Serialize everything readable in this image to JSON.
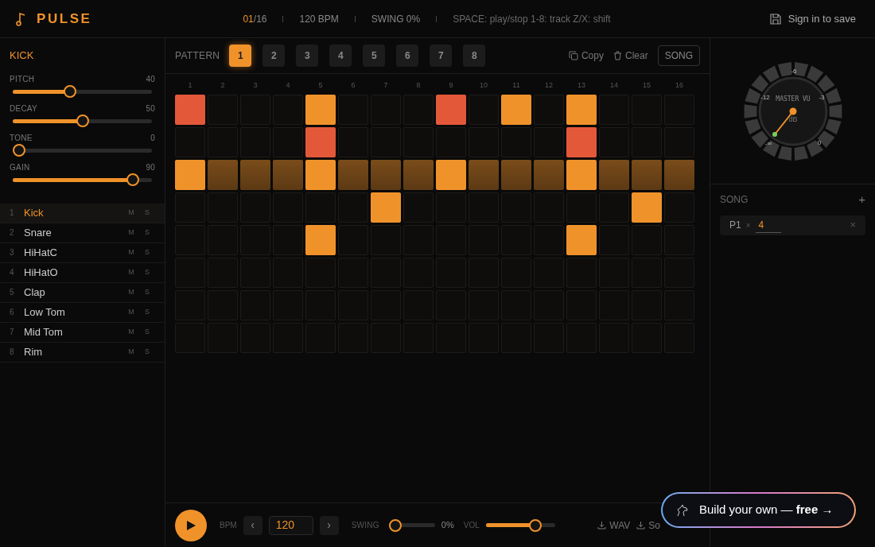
{
  "header": {
    "logo": "PULSE",
    "step_current": "01",
    "step_total": "/16",
    "bpm": "120 BPM",
    "swing": "SWING 0%",
    "hint": "SPACE: play/stop 1-8: track Z/X: shift",
    "sign_in": "Sign in to save"
  },
  "instrument": {
    "title": "KICK",
    "params": [
      {
        "label": "PITCH",
        "value": "40",
        "level": 0.4
      },
      {
        "label": "DECAY",
        "value": "50",
        "level": 0.5
      },
      {
        "label": "TONE",
        "value": "0",
        "level": 0
      },
      {
        "label": "GAIN",
        "value": "90",
        "level": 0.9
      }
    ]
  },
  "tracks": [
    {
      "index": "1",
      "name": "Kick",
      "mute": "M",
      "solo": "S",
      "selected": true
    },
    {
      "index": "2",
      "name": "Snare",
      "mute": "M",
      "solo": "S",
      "selected": false
    },
    {
      "index": "3",
      "name": "HiHatC",
      "mute": "M",
      "solo": "S",
      "selected": false
    },
    {
      "index": "4",
      "name": "HiHatO",
      "mute": "M",
      "solo": "S",
      "selected": false
    },
    {
      "index": "5",
      "name": "Clap",
      "mute": "M",
      "solo": "S",
      "selected": false
    },
    {
      "index": "6",
      "name": "Low Tom",
      "mute": "M",
      "solo": "S",
      "selected": false
    },
    {
      "index": "7",
      "name": "Mid Tom",
      "mute": "M",
      "solo": "S",
      "selected": false
    },
    {
      "index": "8",
      "name": "Rim",
      "mute": "M",
      "solo": "S",
      "selected": false
    }
  ],
  "pattern_bar": {
    "label": "PATTERN",
    "patterns": [
      {
        "label": "1",
        "selected": true
      },
      {
        "label": "2",
        "selected": false
      },
      {
        "label": "3",
        "selected": false
      },
      {
        "label": "4",
        "selected": false
      },
      {
        "label": "5",
        "selected": false
      },
      {
        "label": "6",
        "selected": false
      },
      {
        "label": "7",
        "selected": false
      },
      {
        "label": "8",
        "selected": false
      }
    ],
    "copy": "Copy",
    "clear": "Clear",
    "song": "SONG"
  },
  "step_numbers": [
    "1",
    "2",
    "3",
    "4",
    "5",
    "6",
    "7",
    "8",
    "9",
    "10",
    "11",
    "12",
    "13",
    "14",
    "15",
    "16"
  ],
  "grid": [
    {
      "steps": [
        {
          "kind": "accent"
        },
        {
          "kind": "off"
        },
        {
          "kind": "off"
        },
        {
          "kind": "off"
        },
        {
          "kind": "on"
        },
        {
          "kind": "off"
        },
        {
          "kind": "off"
        },
        {
          "kind": "off"
        },
        {
          "kind": "accent"
        },
        {
          "kind": "off"
        },
        {
          "kind": "on"
        },
        {
          "kind": "off"
        },
        {
          "kind": "on"
        },
        {
          "kind": "off"
        },
        {
          "kind": "off"
        },
        {
          "kind": "off"
        }
      ]
    },
    {
      "steps": [
        {
          "kind": "off"
        },
        {
          "kind": "off"
        },
        {
          "kind": "off"
        },
        {
          "kind": "off"
        },
        {
          "kind": "accent"
        },
        {
          "kind": "off"
        },
        {
          "kind": "off"
        },
        {
          "kind": "off"
        },
        {
          "kind": "off"
        },
        {
          "kind": "off"
        },
        {
          "kind": "off"
        },
        {
          "kind": "off"
        },
        {
          "kind": "accent"
        },
        {
          "kind": "off"
        },
        {
          "kind": "off"
        },
        {
          "kind": "off"
        }
      ]
    },
    {
      "steps": [
        {
          "kind": "on"
        },
        {
          "kind": "ghost"
        },
        {
          "kind": "ghost"
        },
        {
          "kind": "ghost"
        },
        {
          "kind": "on"
        },
        {
          "kind": "ghost"
        },
        {
          "kind": "ghost"
        },
        {
          "kind": "ghost"
        },
        {
          "kind": "on"
        },
        {
          "kind": "ghost"
        },
        {
          "kind": "ghost"
        },
        {
          "kind": "ghost"
        },
        {
          "kind": "on"
        },
        {
          "kind": "ghost"
        },
        {
          "kind": "ghost"
        },
        {
          "kind": "ghost"
        }
      ]
    },
    {
      "steps": [
        {
          "kind": "off"
        },
        {
          "kind": "off"
        },
        {
          "kind": "off"
        },
        {
          "kind": "off"
        },
        {
          "kind": "off"
        },
        {
          "kind": "off"
        },
        {
          "kind": "on"
        },
        {
          "kind": "off"
        },
        {
          "kind": "off"
        },
        {
          "kind": "off"
        },
        {
          "kind": "off"
        },
        {
          "kind": "off"
        },
        {
          "kind": "off"
        },
        {
          "kind": "off"
        },
        {
          "kind": "on"
        },
        {
          "kind": "off"
        }
      ]
    },
    {
      "steps": [
        {
          "kind": "off"
        },
        {
          "kind": "off"
        },
        {
          "kind": "off"
        },
        {
          "kind": "off"
        },
        {
          "kind": "on"
        },
        {
          "kind": "off"
        },
        {
          "kind": "off"
        },
        {
          "kind": "off"
        },
        {
          "kind": "off"
        },
        {
          "kind": "off"
        },
        {
          "kind": "off"
        },
        {
          "kind": "off"
        },
        {
          "kind": "on"
        },
        {
          "kind": "off"
        },
        {
          "kind": "off"
        },
        {
          "kind": "off"
        }
      ]
    },
    {
      "steps": [
        {
          "kind": "off"
        },
        {
          "kind": "off"
        },
        {
          "kind": "off"
        },
        {
          "kind": "off"
        },
        {
          "kind": "off"
        },
        {
          "kind": "off"
        },
        {
          "kind": "off"
        },
        {
          "kind": "off"
        },
        {
          "kind": "off"
        },
        {
          "kind": "off"
        },
        {
          "kind": "off"
        },
        {
          "kind": "off"
        },
        {
          "kind": "off"
        },
        {
          "kind": "off"
        },
        {
          "kind": "off"
        },
        {
          "kind": "off"
        }
      ]
    },
    {
      "steps": [
        {
          "kind": "off"
        },
        {
          "kind": "off"
        },
        {
          "kind": "off"
        },
        {
          "kind": "off"
        },
        {
          "kind": "off"
        },
        {
          "kind": "off"
        },
        {
          "kind": "off"
        },
        {
          "kind": "off"
        },
        {
          "kind": "off"
        },
        {
          "kind": "off"
        },
        {
          "kind": "off"
        },
        {
          "kind": "off"
        },
        {
          "kind": "off"
        },
        {
          "kind": "off"
        },
        {
          "kind": "off"
        },
        {
          "kind": "off"
        }
      ]
    },
    {
      "steps": [
        {
          "kind": "off"
        },
        {
          "kind": "off"
        },
        {
          "kind": "off"
        },
        {
          "kind": "off"
        },
        {
          "kind": "off"
        },
        {
          "kind": "off"
        },
        {
          "kind": "off"
        },
        {
          "kind": "off"
        },
        {
          "kind": "off"
        },
        {
          "kind": "off"
        },
        {
          "kind": "off"
        },
        {
          "kind": "off"
        },
        {
          "kind": "off"
        },
        {
          "kind": "off"
        },
        {
          "kind": "off"
        },
        {
          "kind": "off"
        }
      ]
    }
  ],
  "transport": {
    "bpm_label": "BPM",
    "prev": "‹",
    "bpm_value": "120",
    "next": "›",
    "swing_label": "SWING",
    "swing": {
      "level": 0
    },
    "swing_value": "0%",
    "vol_label": "VOL",
    "vol": {
      "level": 0.77
    },
    "export_wav": "WAV",
    "export_song": "So"
  },
  "vu": {
    "title": "MASTER VU",
    "unit": "dB",
    "scale": [
      "-12",
      "-6",
      "-3",
      "-∞",
      "0"
    ]
  },
  "song": {
    "title": "SONG",
    "add": "+",
    "entries": [
      {
        "pattern": "P1",
        "times": "×",
        "repeats": "4",
        "remove": "×"
      }
    ]
  },
  "promo": {
    "text": "Build your own — **free** →"
  }
}
